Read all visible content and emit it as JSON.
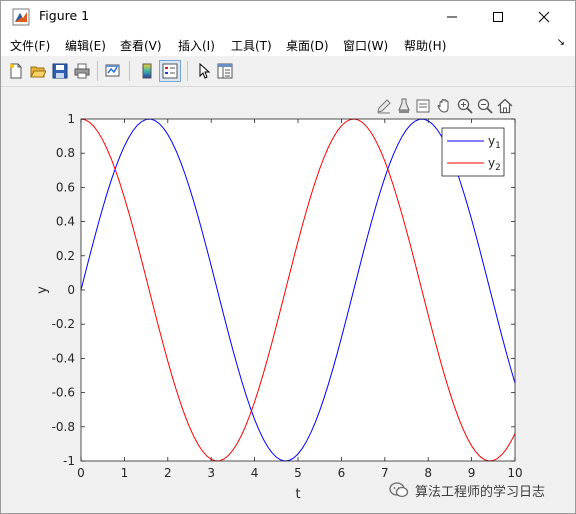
{
  "window": {
    "title": "Figure 1"
  },
  "menu": {
    "items": [
      {
        "label": "文件(F)"
      },
      {
        "label": "编辑(E)"
      },
      {
        "label": "查看(V)"
      },
      {
        "label": "插入(I)"
      },
      {
        "label": "工具(T)"
      },
      {
        "label": "桌面(D)"
      },
      {
        "label": "窗口(W)"
      },
      {
        "label": "帮助(H)"
      }
    ]
  },
  "toolbar": {
    "buttons": [
      "new-figure-icon",
      "open-file-icon",
      "save-icon",
      "print-icon",
      "link-plot-icon",
      "insert-colorbar-icon",
      "insert-legend-icon",
      "edit-plot-icon",
      "property-inspector-icon"
    ]
  },
  "axes_toolbar": {
    "buttons": [
      "brush-edit-icon",
      "data-tips-icon",
      "select-icon",
      "pan-icon",
      "zoom-in-icon",
      "zoom-out-icon",
      "home-icon"
    ]
  },
  "chart_data": {
    "type": "line",
    "xlabel": "t",
    "ylabel": "y",
    "xlim": [
      0,
      10
    ],
    "ylim": [
      -1,
      1
    ],
    "x_ticks": [
      "0",
      "1",
      "2",
      "3",
      "4",
      "5",
      "6",
      "7",
      "8",
      "9",
      "10"
    ],
    "y_ticks": [
      "1",
      "0.8",
      "0.6",
      "0.4",
      "0.2",
      "0",
      "-0.2",
      "-0.4",
      "-0.6",
      "-0.8",
      "-1"
    ],
    "grid": false,
    "legend_position": "top-right",
    "series": [
      {
        "name": "y1",
        "legend_base": "y",
        "legend_sub": "1",
        "color": "#0000ff",
        "function": "sin(t)",
        "t_step": 0.1
      },
      {
        "name": "y2",
        "legend_base": "y",
        "legend_sub": "2",
        "color": "#ff0000",
        "function": "cos(t)",
        "t_step": 0.1
      }
    ]
  },
  "watermark": {
    "text": "算法工程师的学习日志"
  }
}
